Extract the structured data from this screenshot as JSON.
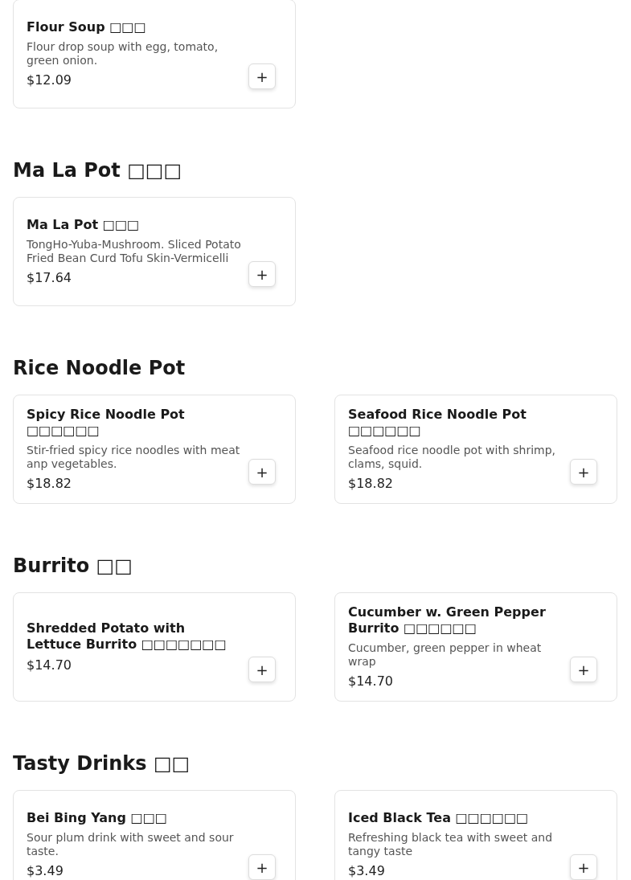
{
  "top_items": [
    {
      "name": "Flour Soup □□□",
      "description": "Flour drop soup with egg, tomato, green onion.",
      "price": "$12.09",
      "add": "+"
    }
  ],
  "sections": [
    {
      "title": "Ma La Pot □□□",
      "items": [
        {
          "name": "Ma La Pot □□□",
          "description": "TongHo-Yuba-Mushroom. Sliced Potato Fried Bean Curd Tofu Skin-Vermicelli",
          "price": "$17.64",
          "add": "+"
        }
      ]
    },
    {
      "title": "Rice Noodle Pot",
      "items": [
        {
          "name": "Spicy Rice Noodle Pot □□□□□□",
          "description": "Stir-fried spicy rice noodles with meat anp vegetables.",
          "price": "$18.82",
          "add": "+"
        },
        {
          "name": "Seafood Rice Noodle Pot □□□□□□",
          "description": "Seafood rice noodle pot with shrimp, clams, squid.",
          "price": "$18.82",
          "add": "+"
        }
      ]
    },
    {
      "title": "Burrito □□",
      "items": [
        {
          "name": "Shredded Potato with Lettuce Burrito □□□□□□□",
          "price": "$14.70",
          "add": "+"
        },
        {
          "name": "Cucumber w. Green Pepper Burrito □□□□□□",
          "description": "Cucumber, green pepper in wheat wrap",
          "price": "$14.70",
          "add": "+"
        }
      ]
    },
    {
      "title": "Tasty Drinks □□",
      "items": [
        {
          "name": "Bei Bing Yang □□□",
          "description": "Sour plum drink with sweet and sour taste.",
          "price": "$3.49",
          "add": "+"
        },
        {
          "name": "Iced Black Tea □□□□□□",
          "description": "Refreshing black tea with sweet and tangy taste",
          "price": "$3.49",
          "add": "+"
        }
      ]
    }
  ]
}
